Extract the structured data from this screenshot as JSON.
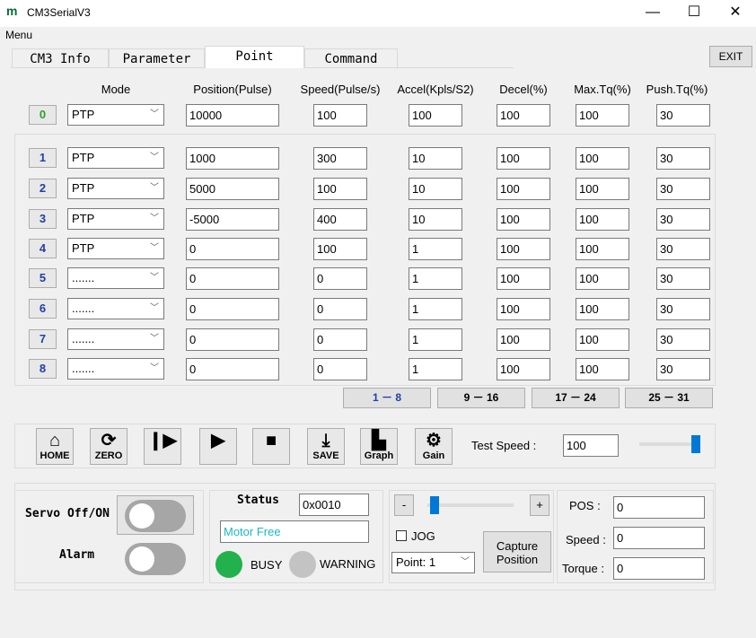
{
  "window": {
    "title": "CM3SerialV3",
    "minimize": "—",
    "maximize": "☐",
    "close": "✕",
    "logo": "m"
  },
  "menu": {
    "label": "Menu"
  },
  "tabs": [
    {
      "label": "CM3 Info"
    },
    {
      "label": "Parameter"
    },
    {
      "label": "Point",
      "active": true
    },
    {
      "label": "Command"
    }
  ],
  "exit_label": "EXIT",
  "headers": {
    "mode": "Mode",
    "position": "Position(Pulse)",
    "speed": "Speed(Pulse/s)",
    "accel": "Accel(Kpls/S2)",
    "decel": "Decel(%)",
    "max_tq": "Max.Tq(%)",
    "push_tq": "Push.Tq(%)"
  },
  "points": [
    {
      "no": "0",
      "mode": "PTP",
      "position": "10000",
      "speed": "100",
      "accel": "100",
      "decel": "100",
      "max_tq": "100",
      "push_tq": "30"
    },
    {
      "no": "1",
      "mode": "PTP",
      "position": "1000",
      "speed": "300",
      "accel": "10",
      "decel": "100",
      "max_tq": "100",
      "push_tq": "30"
    },
    {
      "no": "2",
      "mode": "PTP",
      "position": "5000",
      "speed": "100",
      "accel": "10",
      "decel": "100",
      "max_tq": "100",
      "push_tq": "30"
    },
    {
      "no": "3",
      "mode": "PTP",
      "position": "-5000",
      "speed": "400",
      "accel": "10",
      "decel": "100",
      "max_tq": "100",
      "push_tq": "30"
    },
    {
      "no": "4",
      "mode": "PTP",
      "position": "0",
      "speed": "100",
      "accel": "1",
      "decel": "100",
      "max_tq": "100",
      "push_tq": "30"
    },
    {
      "no": "5",
      "mode": ".......",
      "position": "0",
      "speed": "0",
      "accel": "1",
      "decel": "100",
      "max_tq": "100",
      "push_tq": "30"
    },
    {
      "no": "6",
      "mode": ".......",
      "position": "0",
      "speed": "0",
      "accel": "1",
      "decel": "100",
      "max_tq": "100",
      "push_tq": "30"
    },
    {
      "no": "7",
      "mode": ".......",
      "position": "0",
      "speed": "0",
      "accel": "1",
      "decel": "100",
      "max_tq": "100",
      "push_tq": "30"
    },
    {
      "no": "8",
      "mode": ".......",
      "position": "0",
      "speed": "0",
      "accel": "1",
      "decel": "100",
      "max_tq": "100",
      "push_tq": "30"
    }
  ],
  "pages": [
    {
      "label": "1 － 8",
      "active": true
    },
    {
      "label": "9 － 16"
    },
    {
      "label": "17 － 24"
    },
    {
      "label": "25 － 31"
    }
  ],
  "toolbar": [
    {
      "id": "home",
      "label": "HOME",
      "icon": "home-icon",
      "glyph": "⌂"
    },
    {
      "id": "zero",
      "label": "ZERO",
      "icon": "refresh-icon",
      "glyph": "⟳"
    },
    {
      "id": "step",
      "label": "",
      "icon": "step-forward-icon",
      "glyph": "❙▶"
    },
    {
      "id": "play",
      "label": "",
      "icon": "play-icon",
      "glyph": "▶"
    },
    {
      "id": "stop",
      "label": "",
      "icon": "stop-icon",
      "glyph": "■"
    },
    {
      "id": "save",
      "label": "SAVE",
      "icon": "download-icon",
      "glyph": "⤓"
    },
    {
      "id": "graph",
      "label": "Graph",
      "icon": "graph-icon",
      "glyph": "▙"
    },
    {
      "id": "gain",
      "label": "Gain",
      "icon": "gear-icon",
      "glyph": "⚙"
    }
  ],
  "test_speed": {
    "label": "Test Speed :",
    "value": "100",
    "slider_percent": 100
  },
  "servo": {
    "label": "Servo Off/ON",
    "alarm_label": "Alarm"
  },
  "status": {
    "label": "Status",
    "code": "0x0010",
    "text": "Motor Free",
    "busy_label": "BUSY",
    "warning_label": "WARNING",
    "busy_color": "#22b14c",
    "warning_color": "#c3c3c3",
    "text_color": "#1fb5c8"
  },
  "jog": {
    "minus": "-",
    "plus": "+",
    "label": "JOG",
    "checked": false,
    "point_select": "Point: 1",
    "capture_label": "Capture Position",
    "slider_percent": 0
  },
  "readout": {
    "pos_label": "POS :",
    "pos": "0",
    "speed_label": "Speed :",
    "speed": "0",
    "torque_label": "Torque :",
    "torque": "0"
  },
  "colors": {
    "accent": "#0078d7",
    "number": "#1f3fa8",
    "zero_number": "#2ca02c"
  }
}
